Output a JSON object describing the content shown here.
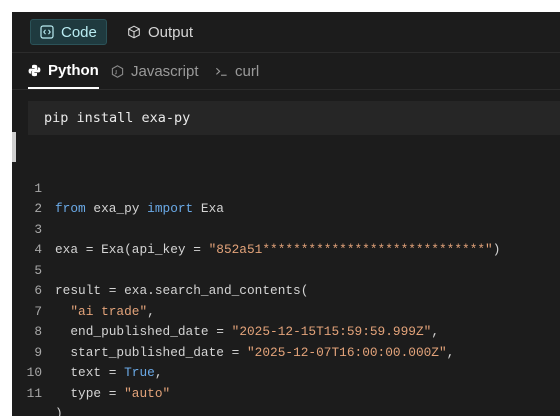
{
  "top_tabs": [
    {
      "label": "Code",
      "icon": "code-brackets-icon",
      "active": true
    },
    {
      "label": "Output",
      "icon": "cube-icon",
      "active": false
    }
  ],
  "lang_tabs": [
    {
      "label": "Python",
      "icon": "python-icon",
      "active": true
    },
    {
      "label": "Javascript",
      "icon": "javascript-icon",
      "active": false
    },
    {
      "label": "curl",
      "icon": "terminal-icon",
      "active": false
    }
  ],
  "install_command": "pip install exa-py",
  "code": {
    "line_numbers": [
      "1",
      "2",
      "3",
      "4",
      "5",
      "6",
      "7",
      "8",
      "9",
      "10",
      "11"
    ],
    "l1": {
      "kw1": "from",
      "mid": " exa_py ",
      "kw2": "import",
      "rest": " Exa"
    },
    "l3": {
      "pre": "exa = Exa(api_key = ",
      "str": "\"852a51*****************************\"",
      "post": ")"
    },
    "l5": {
      "text": "result = exa.search_and_contents("
    },
    "l6": {
      "pre": "  ",
      "str": "\"ai trade\"",
      "post": ","
    },
    "l7": {
      "pre": "  end_published_date = ",
      "str": "\"2025-12-15T15:59:59.999Z\"",
      "post": ","
    },
    "l8": {
      "pre": "  start_published_date = ",
      "str": "\"2025-12-07T16:00:00.000Z\"",
      "post": ","
    },
    "l9": {
      "pre": "  text = ",
      "bool": "True",
      "post": ","
    },
    "l10": {
      "pre": "  type = ",
      "str": "\"auto\""
    },
    "l11": {
      "text": ")"
    }
  },
  "colors": {
    "panel_bg": "#1c1c1c",
    "active_tab_bg": "#1f3a3f",
    "keyword": "#6aa9e6",
    "string": "#e3a37a"
  }
}
